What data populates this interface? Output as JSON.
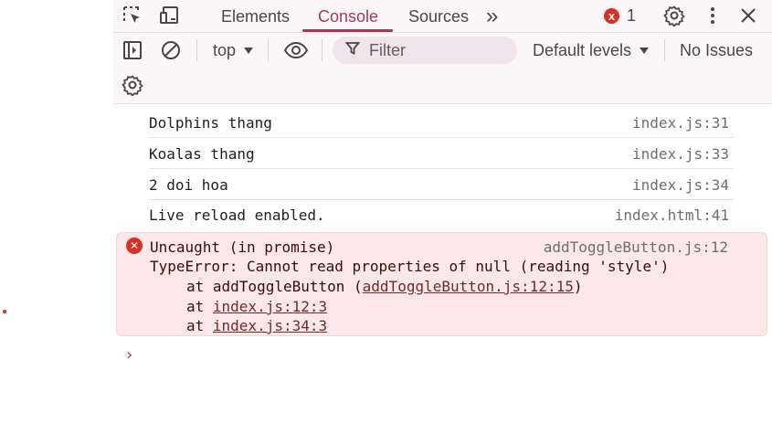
{
  "tabs": {
    "elements": "Elements",
    "console": "Console",
    "sources": "Sources",
    "more": "»"
  },
  "error_badge": {
    "count": "1",
    "icon": "x",
    "color": "#d93025"
  },
  "toolbar": {
    "context": "top",
    "filter_placeholder": "Filter",
    "levels": "Default levels",
    "issues": "No Issues"
  },
  "messages": [
    {
      "text": "Dolphins thang",
      "source": "index.js:31"
    },
    {
      "text": "Koalas thang",
      "source": "index.js:33"
    },
    {
      "text": "2 doi hoa",
      "source": "index.js:34"
    },
    {
      "text": "Live reload enabled.",
      "source": "index.html:41"
    }
  ],
  "error": {
    "title": "Uncaught (in promise)",
    "source": "addToggleButton.js:12",
    "message": "TypeError: Cannot read properties of null (reading 'style')",
    "stack": [
      {
        "prefix": "at addToggleButton (",
        "link": "addToggleButton.js:12:15",
        "suffix": ")"
      },
      {
        "prefix": "at ",
        "link": "index.js:12:3",
        "suffix": ""
      },
      {
        "prefix": "at ",
        "link": "index.js:34:3",
        "suffix": ""
      }
    ]
  },
  "prompt": "›",
  "colors": {
    "accent": "#a5385c",
    "error": "#d93025",
    "error_bg": "#fce8e8"
  }
}
